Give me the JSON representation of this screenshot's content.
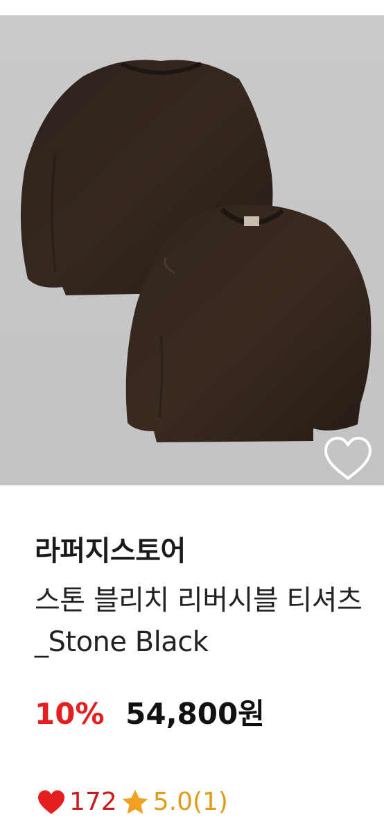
{
  "product": {
    "brand": "라퍼지스토어",
    "title": "스톤 블리치 리버시블 티셔츠_Stone Black",
    "discount": "10%",
    "price": "54,800원",
    "likes": "172",
    "rating": "5.0(1)",
    "image_alt": "Stone Black reversible sweatshirts"
  },
  "colors": {
    "discount": "#e51f1f",
    "heart": "#e51f1f",
    "star": "#f2a01f",
    "garment": "#2a2019",
    "image_bg": "#c9c8c8"
  },
  "icons": {
    "wish": "heart-outline-icon",
    "likes": "heart-filled-icon",
    "rating": "star-icon"
  }
}
